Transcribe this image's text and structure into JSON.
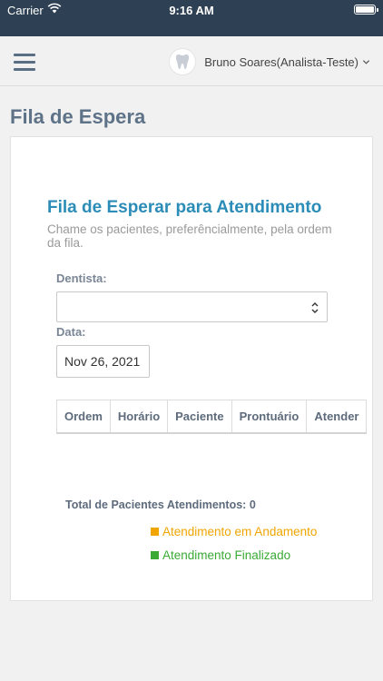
{
  "status_bar": {
    "carrier": "Carrier",
    "time": "9:16 AM"
  },
  "header": {
    "menu_icon": "hamburger-icon",
    "avatar_icon": "tooth-icon",
    "user_name": "Bruno Soares(Analista-Teste)",
    "dropdown_icon": "chevron-down-icon"
  },
  "page": {
    "title": "Fila de Espera"
  },
  "panel": {
    "title": "Fila de Esperar para Atendimento",
    "subtitle": "Chame os pacientes, preferêncialmente, pela ordem da fila.",
    "dentist_label": "Dentista:",
    "dentist_selected": "",
    "date_label": "Data:",
    "date_value": "Nov 26, 2021"
  },
  "table": {
    "columns": [
      "Ordem",
      "Horário",
      "Paciente",
      "Prontuário",
      "Atender"
    ],
    "rows": []
  },
  "summary": {
    "total_text": "Total de Pacientes Atendimentos: 0"
  },
  "legend": [
    {
      "label": "Atendimento em Andamento",
      "color": "#f0a500"
    },
    {
      "label": "Atendimento Finalizado",
      "color": "#3aaa35"
    }
  ],
  "colors": {
    "status_bar_bg": "#2e4053",
    "title_blue": "#2b8cb8",
    "page_title": "#5f7388"
  }
}
